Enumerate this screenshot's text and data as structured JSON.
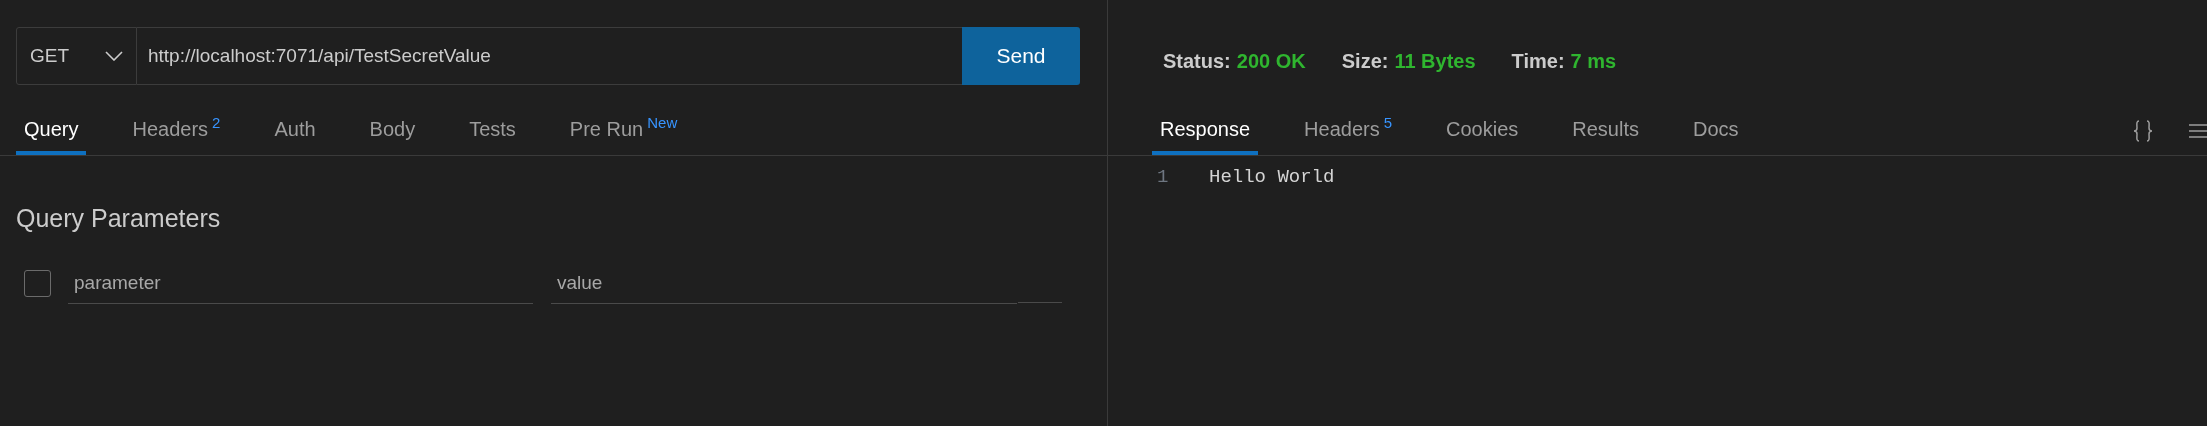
{
  "request": {
    "method": "GET",
    "url": "http://localhost:7071/api/TestSecretValue",
    "send_label": "Send"
  },
  "request_tabs": [
    {
      "label": "Query",
      "selected": true
    },
    {
      "label": "Headers",
      "badge": "2",
      "selected": false
    },
    {
      "label": "Auth",
      "selected": false
    },
    {
      "label": "Body",
      "selected": false
    },
    {
      "label": "Tests",
      "selected": false
    },
    {
      "label": "Pre Run",
      "badge": "New",
      "selected": false
    }
  ],
  "query": {
    "title": "Query Parameters",
    "rows": [
      {
        "checked": false,
        "key_placeholder": "parameter",
        "value_placeholder": "value"
      }
    ]
  },
  "response": {
    "stats": [
      {
        "label": "Status:",
        "value": "200 OK"
      },
      {
        "label": "Size:",
        "value": "11 Bytes"
      },
      {
        "label": "Time:",
        "value": "7 ms"
      }
    ],
    "tabs": [
      {
        "label": "Response",
        "selected": true
      },
      {
        "label": "Headers",
        "badge": "5",
        "selected": false
      },
      {
        "label": "Cookies",
        "selected": false
      },
      {
        "label": "Results",
        "selected": false
      },
      {
        "label": "Docs",
        "selected": false
      }
    ],
    "lines": [
      {
        "number": "1",
        "text": "Hello World"
      }
    ]
  }
}
